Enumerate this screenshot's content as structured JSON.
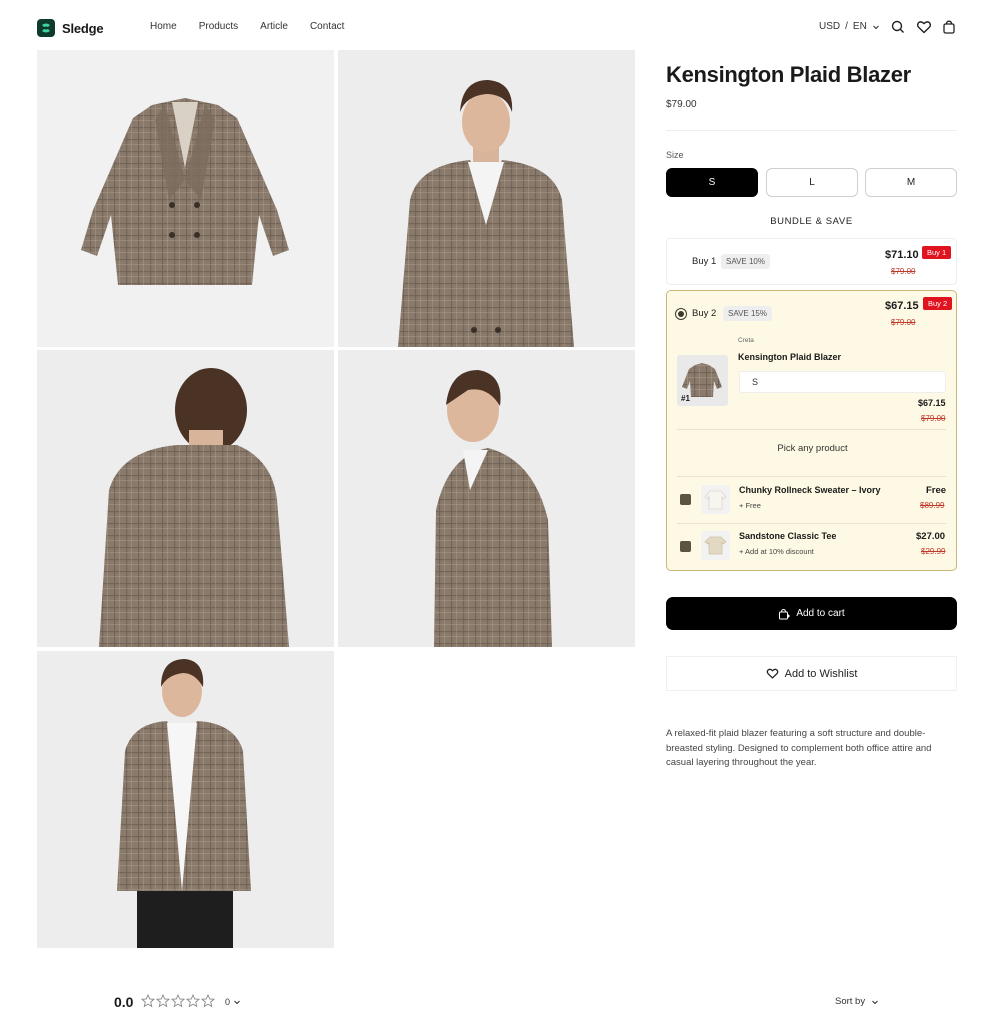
{
  "header": {
    "brand": "Sledge",
    "nav": [
      "Home",
      "Products",
      "Article",
      "Contact"
    ],
    "currency": "USD",
    "locale_sep": "/",
    "language": "EN",
    "icons": [
      "search-icon",
      "heart-icon",
      "bag-icon"
    ]
  },
  "gallery": {
    "images": [
      "jacket-flat-lay",
      "model-front",
      "model-back",
      "model-side",
      "model-full-body"
    ]
  },
  "product": {
    "title": "Kensington Plaid Blazer",
    "price": "$79.00",
    "size_label": "Size",
    "sizes": [
      "S",
      "L",
      "M"
    ],
    "selected_size": "S",
    "bundle_heading": "BUNDLE & SAVE",
    "offers": [
      {
        "label": "Buy 1",
        "tag": "SAVE 10%",
        "price": "$71.10",
        "compare": "$79.00",
        "badge": "Buy 1"
      },
      {
        "label": "Buy 2",
        "tag": "SAVE 15%",
        "price": "$67.15",
        "compare": "$79.00",
        "badge": "Buy 2",
        "vendor": "Creta",
        "item_title": "Kensington Plaid Blazer",
        "item_index": "#1",
        "item_size": "S",
        "item_price": "$67.15",
        "item_compare": "$79.00",
        "pick_label": "Pick any product",
        "addons": [
          {
            "name": "Chunky Rollneck Sweater – Ivory",
            "note": "+ Free",
            "price": "Free",
            "compare": "$89.99"
          },
          {
            "name": "Sandstone Classic Tee",
            "note": "+ Add at 10% discount",
            "price": "$27.00",
            "compare": "$29.99"
          }
        ]
      }
    ],
    "add_to_cart": "Add to cart",
    "add_to_wishlist": "Add to Wishlist",
    "description": "A relaxed-fit plaid blazer featuring a soft structure and double-breasted styling. Designed to complement both office attire and casual layering throughout the year."
  },
  "reviews": {
    "rating": "0.0",
    "count": "0",
    "sort_label": "Sort by"
  },
  "colors": {
    "accent": "#000000",
    "badge": "#e0141e",
    "bundle_bg": "#fdf9e4",
    "bundle_border": "#c9b87a",
    "plaid": "#8a7a6c"
  }
}
